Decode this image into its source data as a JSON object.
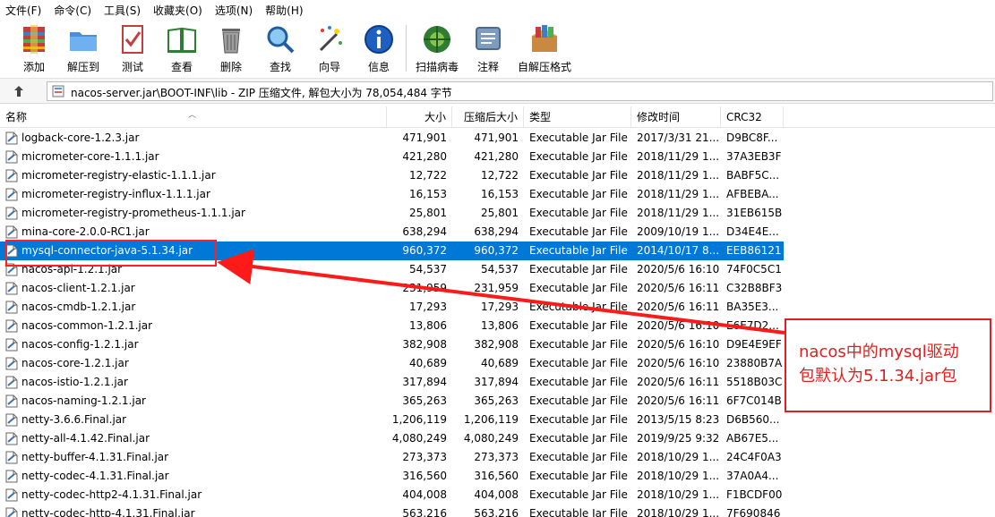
{
  "menu": [
    "文件(F)",
    "命令(C)",
    "工具(S)",
    "收藏夹(O)",
    "选项(N)",
    "帮助(H)"
  ],
  "toolbar": [
    {
      "label": "添加",
      "icon": "add-archive-icon"
    },
    {
      "label": "解压到",
      "icon": "extract-to-icon"
    },
    {
      "label": "测试",
      "icon": "test-icon"
    },
    {
      "label": "查看",
      "icon": "view-icon"
    },
    {
      "label": "删除",
      "icon": "delete-icon"
    },
    {
      "label": "查找",
      "icon": "find-icon"
    },
    {
      "label": "向导",
      "icon": "wizard-icon"
    },
    {
      "label": "信息",
      "icon": "info-icon"
    },
    {
      "label": "扫描病毒",
      "icon": "virus-scan-icon"
    },
    {
      "label": "注释",
      "icon": "comment-icon"
    },
    {
      "label": "自解压格式",
      "icon": "sfx-icon"
    }
  ],
  "address": {
    "path": "nacos-server.jar\\BOOT-INF\\lib - ZIP 压缩文件, 解包大小为 78,054,484 字节"
  },
  "columns": {
    "name": "名称",
    "size": "大小",
    "packed": "压缩后大小",
    "type": "类型",
    "modified": "修改时间",
    "crc": "CRC32"
  },
  "files": [
    {
      "name": "logback-core-1.2.3.jar",
      "size": "471,901",
      "packed": "471,901",
      "type": "Executable Jar File",
      "modified": "2017/3/31 21...",
      "crc": "D9BC8F..."
    },
    {
      "name": "micrometer-core-1.1.1.jar",
      "size": "421,280",
      "packed": "421,280",
      "type": "Executable Jar File",
      "modified": "2018/11/29 1...",
      "crc": "37A3EB3F"
    },
    {
      "name": "micrometer-registry-elastic-1.1.1.jar",
      "size": "12,722",
      "packed": "12,722",
      "type": "Executable Jar File",
      "modified": "2018/11/29 1...",
      "crc": "BABF5C..."
    },
    {
      "name": "micrometer-registry-influx-1.1.1.jar",
      "size": "16,153",
      "packed": "16,153",
      "type": "Executable Jar File",
      "modified": "2018/11/29 1...",
      "crc": "AFBEBA..."
    },
    {
      "name": "micrometer-registry-prometheus-1.1.1.jar",
      "size": "25,801",
      "packed": "25,801",
      "type": "Executable Jar File",
      "modified": "2018/11/29 1...",
      "crc": "31EB615B"
    },
    {
      "name": "mina-core-2.0.0-RC1.jar",
      "size": "638,294",
      "packed": "638,294",
      "type": "Executable Jar File",
      "modified": "2009/10/19 1...",
      "crc": "D34E4E..."
    },
    {
      "name": "mysql-connector-java-5.1.34.jar",
      "size": "960,372",
      "packed": "960,372",
      "type": "Executable Jar File",
      "modified": "2014/10/17 8...",
      "crc": "EEB86121"
    },
    {
      "name": "nacos-api-1.2.1.jar",
      "size": "54,537",
      "packed": "54,537",
      "type": "Executable Jar File",
      "modified": "2020/5/6 16:10",
      "crc": "74F0C5C1"
    },
    {
      "name": "nacos-client-1.2.1.jar",
      "size": "231,959",
      "packed": "231,959",
      "type": "Executable Jar File",
      "modified": "2020/5/6 16:11",
      "crc": "C32B8BF3"
    },
    {
      "name": "nacos-cmdb-1.2.1.jar",
      "size": "17,293",
      "packed": "17,293",
      "type": "Executable Jar File",
      "modified": "2020/5/6 16:11",
      "crc": "BA35E3..."
    },
    {
      "name": "nacos-common-1.2.1.jar",
      "size": "13,806",
      "packed": "13,806",
      "type": "Executable Jar File",
      "modified": "2020/5/6 16:10",
      "crc": "E6E7D2..."
    },
    {
      "name": "nacos-config-1.2.1.jar",
      "size": "382,908",
      "packed": "382,908",
      "type": "Executable Jar File",
      "modified": "2020/5/6 16:10",
      "crc": "D9E4E9EF"
    },
    {
      "name": "nacos-core-1.2.1.jar",
      "size": "40,689",
      "packed": "40,689",
      "type": "Executable Jar File",
      "modified": "2020/5/6 16:10",
      "crc": "23880B7A"
    },
    {
      "name": "nacos-istio-1.2.1.jar",
      "size": "317,894",
      "packed": "317,894",
      "type": "Executable Jar File",
      "modified": "2020/5/6 16:11",
      "crc": "5518B03C"
    },
    {
      "name": "nacos-naming-1.2.1.jar",
      "size": "365,263",
      "packed": "365,263",
      "type": "Executable Jar File",
      "modified": "2020/5/6 16:11",
      "crc": "6F7C014B"
    },
    {
      "name": "netty-3.6.6.Final.jar",
      "size": "1,206,119",
      "packed": "1,206,119",
      "type": "Executable Jar File",
      "modified": "2013/5/15 8:23",
      "crc": "D6B560..."
    },
    {
      "name": "netty-all-4.1.42.Final.jar",
      "size": "4,080,249",
      "packed": "4,080,249",
      "type": "Executable Jar File",
      "modified": "2019/9/25 9:32",
      "crc": "AB67E5..."
    },
    {
      "name": "netty-buffer-4.1.31.Final.jar",
      "size": "273,373",
      "packed": "273,373",
      "type": "Executable Jar File",
      "modified": "2018/10/29 1...",
      "crc": "24C4F0A3"
    },
    {
      "name": "netty-codec-4.1.31.Final.jar",
      "size": "316,560",
      "packed": "316,560",
      "type": "Executable Jar File",
      "modified": "2018/10/29 1...",
      "crc": "37A0A4..."
    },
    {
      "name": "netty-codec-http2-4.1.31.Final.jar",
      "size": "404,008",
      "packed": "404,008",
      "type": "Executable Jar File",
      "modified": "2018/10/29 1...",
      "crc": "F1BCDF00"
    },
    {
      "name": "netty-codec-http-4.1.31.Final.jar",
      "size": "563,216",
      "packed": "563,216",
      "type": "Executable Jar File",
      "modified": "2018/10/29 1...",
      "crc": "7F690846"
    }
  ],
  "selected_index": 6,
  "annotation": {
    "line1": "nacos中的mysql驱动",
    "line2": "包默认为5.1.34.jar包",
    "color": "#e02020"
  },
  "colors": {
    "selection": "#0078d7"
  }
}
